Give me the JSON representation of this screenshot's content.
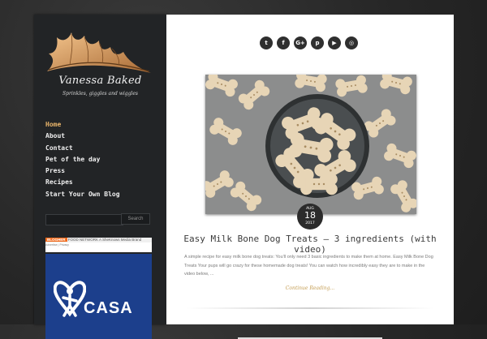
{
  "site": {
    "title": "Vanessa Baked",
    "tagline": "Sprinkles, giggles and wiggles"
  },
  "nav": {
    "items": [
      {
        "label": "Home",
        "active": true
      },
      {
        "label": "About"
      },
      {
        "label": "Contact"
      },
      {
        "label": "Pet of the day"
      },
      {
        "label": "Press"
      },
      {
        "label": "Recipes"
      },
      {
        "label": "Start Your Own Blog"
      }
    ]
  },
  "search": {
    "placeholder": "",
    "button_label": "Search"
  },
  "badge": {
    "brand": "BLOGHER",
    "network": "FOOD NETWORK",
    "member": "A SheKnows Media Brand",
    "sub": "Advertise | Privacy"
  },
  "casa": {
    "text": "CASA"
  },
  "social": [
    "twitter-icon",
    "facebook-icon",
    "google-plus-icon",
    "pinterest-icon",
    "youtube-icon",
    "instagram-icon"
  ],
  "post": {
    "date_month": "AUG",
    "date_day": "18",
    "date_year": "2017",
    "title": "Easy Milk Bone Dog Treats – 3 ingredients (with video)",
    "excerpt": "A simple recipe for easy milk bone dog treats: You'll only need 3 basic ingredients to make them at home. Easy Milk Bone Dog Treats Your pups will go crazy for these homemade dog treats! You can watch how incredibly easy they are to make in the video below, ...",
    "read_more": "Continue Reading..."
  },
  "colors": {
    "accent": "#e8b46a",
    "read_more": "#c49d52",
    "casa_blue": "#1c3f8c"
  }
}
